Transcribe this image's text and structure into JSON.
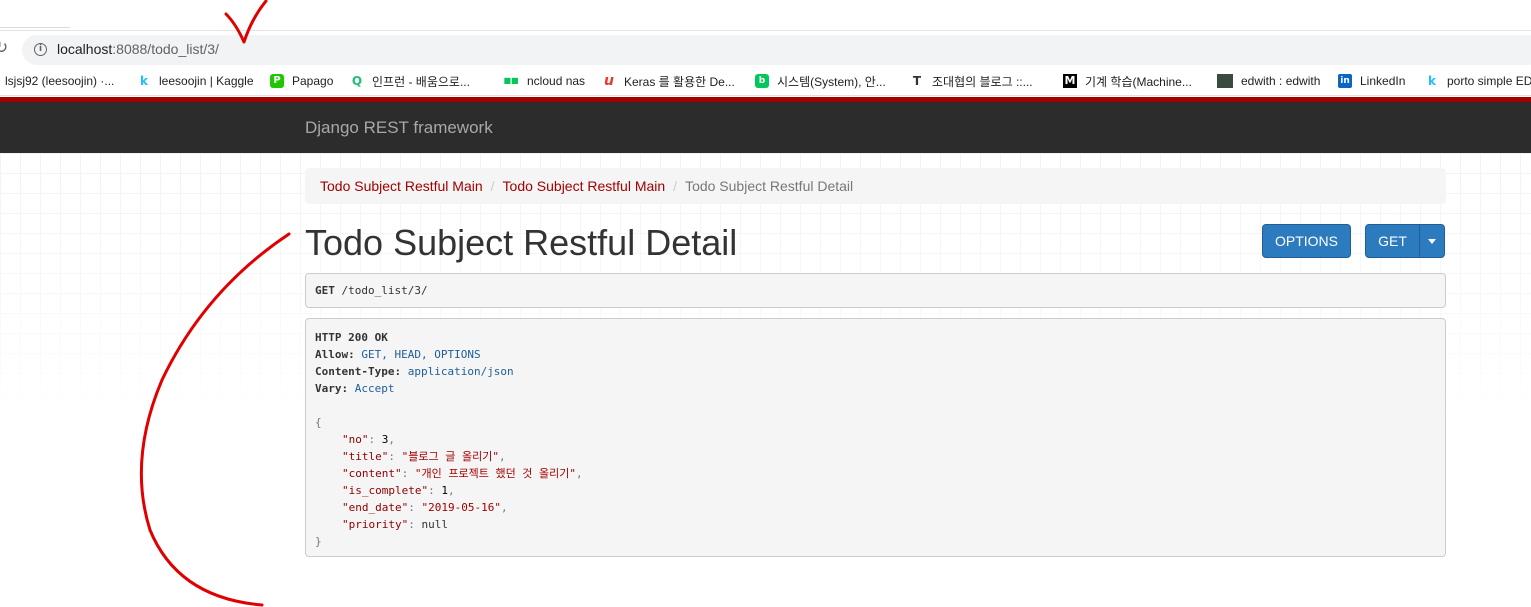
{
  "browser": {
    "url_host": "localhost",
    "url_rest": ":8088/todo_list/3/",
    "bookmarks": [
      {
        "label": "lsjsj92 (leesoojin) ·...",
        "icon": ""
      },
      {
        "label": "leesoojin | Kaggle",
        "icon": "k",
        "color": "#20beff"
      },
      {
        "label": "Papago",
        "icon": "P",
        "color": "#1ec800"
      },
      {
        "label": "인프런 - 배움으로...",
        "icon": "Q",
        "color": "#1dc078"
      },
      {
        "label": "ncloud nas",
        "icon": "■■",
        "color": "#03c75a"
      },
      {
        "label": "Keras 를 활용한 De...",
        "icon": "u",
        "color": "#e53935"
      },
      {
        "label": "시스템(System), 안...",
        "icon": "b",
        "color": "#03c75a"
      },
      {
        "label": "조대협의 블로그 ::...",
        "icon": "T",
        "color": "#333333"
      },
      {
        "label": "기계 학습(Machine...",
        "icon": "M",
        "color": "#000000"
      },
      {
        "label": "edwith : edwith",
        "icon": "■",
        "color": "#3a4a3f"
      },
      {
        "label": "LinkedIn",
        "icon": "in",
        "color": "#0a66c2"
      },
      {
        "label": "porto simple ED",
        "icon": "k",
        "color": "#20beff"
      }
    ]
  },
  "navbar": {
    "brand": "Django REST framework"
  },
  "breadcrumb": {
    "items": [
      "Todo Subject Restful Main",
      "Todo Subject Restful Main"
    ],
    "active": "Todo Subject Restful Detail",
    "separator": "/"
  },
  "page": {
    "title": "Todo Subject Restful Detail"
  },
  "buttons": {
    "options": "OPTIONS",
    "get": "GET"
  },
  "request": {
    "method": "GET",
    "path": "/todo_list/3/"
  },
  "response": {
    "status": "HTTP 200 OK",
    "headers": [
      {
        "name": "Allow:",
        "value": "GET, HEAD, OPTIONS"
      },
      {
        "name": "Content-Type:",
        "value": "application/json"
      },
      {
        "name": "Vary:",
        "value": "Accept"
      }
    ],
    "open_brace": "{",
    "close_brace": "}",
    "body": {
      "no": {
        "key": "\"no\"",
        "value": "3"
      },
      "title": {
        "key": "\"title\"",
        "value": "\"블로그 글 올리기\""
      },
      "content": {
        "key": "\"content\"",
        "value": "\"개인 프로젝트 했던 것 올리기\""
      },
      "is_complete": {
        "key": "\"is_complete\"",
        "value": "1"
      },
      "end_date": {
        "key": "\"end_date\"",
        "value": "\"2019-05-16\""
      },
      "priority": {
        "key": "\"priority\"",
        "value": "null"
      }
    }
  },
  "colors": {
    "accent": "#a30000",
    "button": "#2c7bbf",
    "navbar": "#2c2c2c",
    "annotation": "#e00000"
  }
}
